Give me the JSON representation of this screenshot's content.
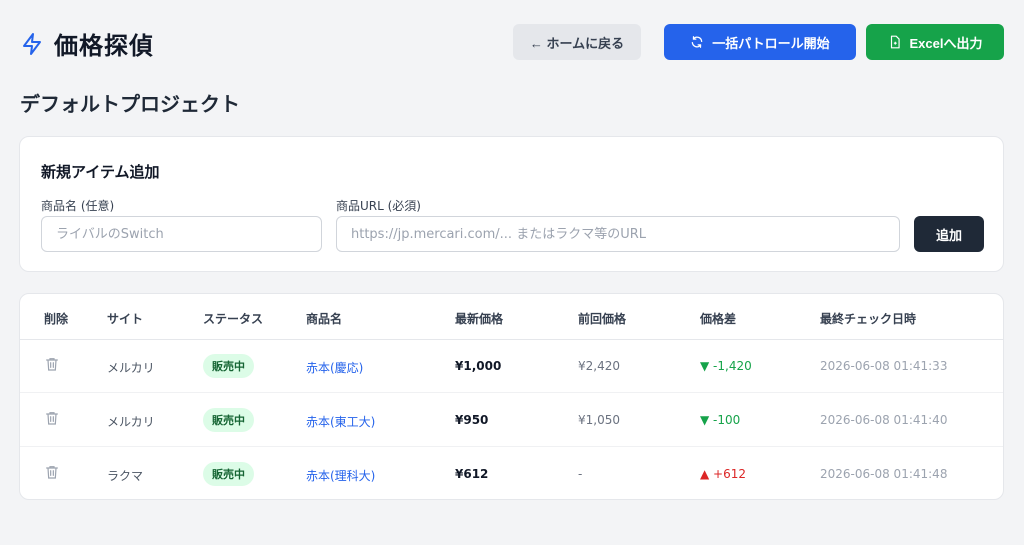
{
  "header": {
    "app_title": "価格探偵",
    "home_button": "← ホームに戻る",
    "patrol_button": "一括パトロール開始",
    "excel_button": "Excelへ出力"
  },
  "project": {
    "title": "デフォルトプロジェクト"
  },
  "add_item": {
    "title": "新規アイテム追加",
    "name_label": "商品名 (任意)",
    "name_placeholder": "ライバルのSwitch",
    "url_label": "商品URL (必須)",
    "url_placeholder": "https://jp.mercari.com/... またはラクマ等のURL",
    "add_button": "追加"
  },
  "table": {
    "headers": [
      "削除",
      "サイト",
      "ステータス",
      "商品名",
      "最新価格",
      "前回価格",
      "価格差",
      "最終チェック日時"
    ],
    "rows": [
      {
        "site": "メルカリ",
        "status": "販売中",
        "name": "赤本(慶応)",
        "latest": "¥1,000",
        "previous": "¥2,420",
        "diff": "▼ -1,420",
        "diff_dir": "down",
        "checked": "2026-06-08 01:41:33"
      },
      {
        "site": "メルカリ",
        "status": "販売中",
        "name": "赤本(東工大)",
        "latest": "¥950",
        "previous": "¥1,050",
        "diff": "▼ -100",
        "diff_dir": "down",
        "checked": "2026-06-08 01:41:40"
      },
      {
        "site": "ラクマ",
        "status": "販売中",
        "name": "赤本(理科大)",
        "latest": "¥612",
        "previous": "-",
        "diff": "▲ +612",
        "diff_dir": "up",
        "checked": "2026-06-08 01:41:48"
      }
    ]
  },
  "colors": {
    "primary": "#2563eb",
    "success": "#16a34a",
    "danger": "#dc2626",
    "dark": "#1f2937"
  }
}
